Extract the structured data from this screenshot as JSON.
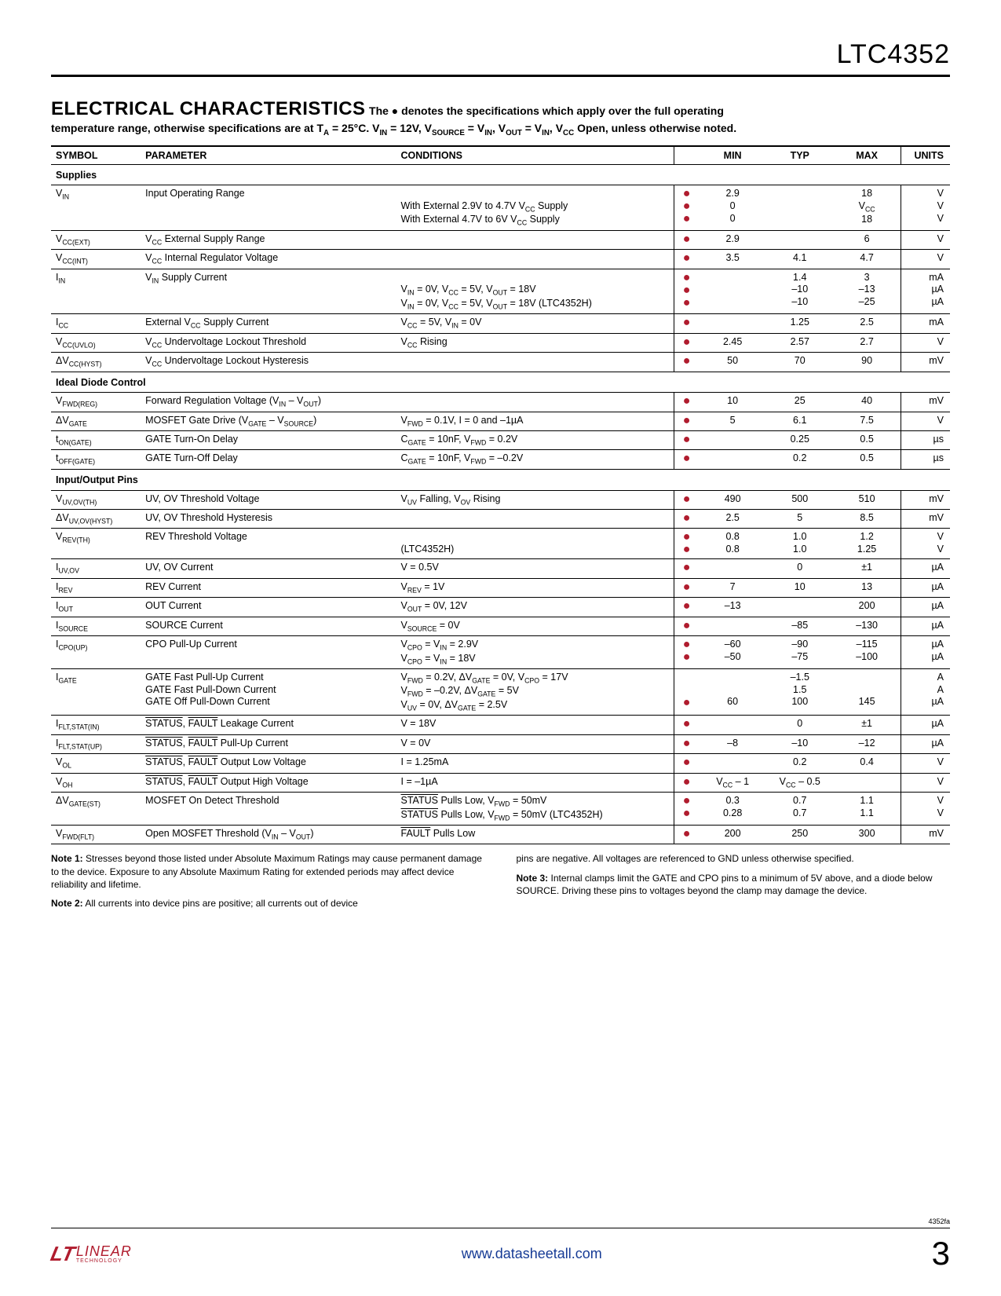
{
  "part_number": "LTC4352",
  "section_title": "ELECTRICAL CHARACTERISTICS",
  "header_text_1": "  The ● denotes the specifications which apply over the full operating",
  "header_text_2": "temperature range, otherwise specifications are at TA = 25°C. VIN = 12V, VSOURCE = VIN, VOUT = VIN, VCC Open, unless otherwise noted.",
  "columns": {
    "symbol": "SYMBOL",
    "parameter": "PARAMETER",
    "conditions": "CONDITIONS",
    "min": "MIN",
    "typ": "TYP",
    "max": "MAX",
    "units": "UNITS"
  },
  "groups": [
    {
      "name": "Supplies",
      "rows": [
        {
          "sym": "V<sub>IN</sub>",
          "param": "Input Operating Range",
          "cond": [
            "",
            "With External 2.9V to 4.7V V<sub>CC</sub> Supply",
            "With External 4.7V to 6V V<sub>CC</sub> Supply"
          ],
          "dot": [
            "●",
            "●",
            "●"
          ],
          "min": [
            "2.9",
            "0",
            "0"
          ],
          "typ": [
            "",
            "",
            ""
          ],
          "max": [
            "18",
            "V<sub>CC</sub>",
            "18"
          ],
          "unit": [
            "V",
            "V",
            "V"
          ]
        },
        {
          "sym": "V<sub>CC(EXT)</sub>",
          "param": "V<sub>CC</sub> External Supply Range",
          "cond": [
            ""
          ],
          "dot": [
            "●"
          ],
          "min": [
            "2.9"
          ],
          "typ": [
            ""
          ],
          "max": [
            "6"
          ],
          "unit": [
            "V"
          ]
        },
        {
          "sym": "V<sub>CC(INT)</sub>",
          "param": "V<sub>CC</sub> Internal Regulator Voltage",
          "cond": [
            ""
          ],
          "dot": [
            "●"
          ],
          "min": [
            "3.5"
          ],
          "typ": [
            "4.1"
          ],
          "max": [
            "4.7"
          ],
          "unit": [
            "V"
          ]
        },
        {
          "sym": "I<sub>IN</sub>",
          "param": "V<sub>IN</sub> Supply Current",
          "cond": [
            "",
            "V<sub>IN</sub> = 0V, V<sub>CC</sub> = 5V, V<sub>OUT</sub> = 18V",
            "V<sub>IN</sub> = 0V, V<sub>CC</sub> = 5V, V<sub>OUT</sub> = 18V (LTC4352H)"
          ],
          "dot": [
            "●",
            "●",
            "●"
          ],
          "min": [
            "",
            "",
            ""
          ],
          "typ": [
            "1.4",
            "–10",
            "–10"
          ],
          "max": [
            "3",
            "–13",
            "–25"
          ],
          "unit": [
            "mA",
            "µA",
            "µA"
          ]
        },
        {
          "sym": "I<sub>CC</sub>",
          "param": "External V<sub>CC</sub> Supply Current",
          "cond": [
            "V<sub>CC</sub> = 5V, V<sub>IN</sub> = 0V"
          ],
          "dot": [
            "●"
          ],
          "min": [
            ""
          ],
          "typ": [
            "1.25"
          ],
          "max": [
            "2.5"
          ],
          "unit": [
            "mA"
          ]
        },
        {
          "sym": "V<sub>CC(UVLO)</sub>",
          "param": "V<sub>CC</sub> Undervoltage Lockout Threshold",
          "cond": [
            "V<sub>CC</sub> Rising"
          ],
          "dot": [
            "●"
          ],
          "min": [
            "2.45"
          ],
          "typ": [
            "2.57"
          ],
          "max": [
            "2.7"
          ],
          "unit": [
            "V"
          ]
        },
        {
          "sym": "ΔV<sub>CC(HYST)</sub>",
          "param": "V<sub>CC</sub> Undervoltage Lockout Hysteresis",
          "cond": [
            ""
          ],
          "dot": [
            "●"
          ],
          "min": [
            "50"
          ],
          "typ": [
            "70"
          ],
          "max": [
            "90"
          ],
          "unit": [
            "mV"
          ]
        }
      ]
    },
    {
      "name": "Ideal Diode Control",
      "rows": [
        {
          "sym": "V<sub>FWD(REG)</sub>",
          "param": "Forward Regulation Voltage (V<sub>IN</sub> – V<sub>OUT</sub>)",
          "cond": [
            ""
          ],
          "dot": [
            "●"
          ],
          "min": [
            "10"
          ],
          "typ": [
            "25"
          ],
          "max": [
            "40"
          ],
          "unit": [
            "mV"
          ]
        },
        {
          "sym": "ΔV<sub>GATE</sub>",
          "param": "MOSFET Gate Drive (V<sub>GATE</sub> – V<sub>SOURCE</sub>)",
          "cond": [
            "V<sub>FWD</sub> = 0.1V, I = 0 and –1µA"
          ],
          "dot": [
            "●"
          ],
          "min": [
            "5"
          ],
          "typ": [
            "6.1"
          ],
          "max": [
            "7.5"
          ],
          "unit": [
            "V"
          ]
        },
        {
          "sym": "t<sub>ON(GATE)</sub>",
          "param": "GATE Turn-On Delay",
          "cond": [
            "C<sub>GATE</sub> = 10nF, V<sub>FWD</sub> = 0.2V"
          ],
          "dot": [
            "●"
          ],
          "min": [
            ""
          ],
          "typ": [
            "0.25"
          ],
          "max": [
            "0.5"
          ],
          "unit": [
            "µs"
          ]
        },
        {
          "sym": "t<sub>OFF(GATE)</sub>",
          "param": "GATE Turn-Off Delay",
          "cond": [
            "C<sub>GATE</sub> = 10nF, V<sub>FWD</sub> = –0.2V"
          ],
          "dot": [
            "●"
          ],
          "min": [
            ""
          ],
          "typ": [
            "0.2"
          ],
          "max": [
            "0.5"
          ],
          "unit": [
            "µs"
          ]
        }
      ]
    },
    {
      "name": "Input/Output Pins",
      "rows": [
        {
          "sym": "V<sub>UV,OV(TH)</sub>",
          "param": "UV, OV Threshold Voltage",
          "cond": [
            "V<sub>UV</sub> Falling, V<sub>OV</sub> Rising"
          ],
          "dot": [
            "●"
          ],
          "min": [
            "490"
          ],
          "typ": [
            "500"
          ],
          "max": [
            "510"
          ],
          "unit": [
            "mV"
          ]
        },
        {
          "sym": "ΔV<sub>UV,OV(HYST)</sub>",
          "param": "UV, OV Threshold Hysteresis",
          "cond": [
            ""
          ],
          "dot": [
            "●"
          ],
          "min": [
            "2.5"
          ],
          "typ": [
            "5"
          ],
          "max": [
            "8.5"
          ],
          "unit": [
            "mV"
          ]
        },
        {
          "sym": "V<sub>REV(TH)</sub>",
          "param": "REV Threshold Voltage",
          "cond": [
            "",
            "(LTC4352H)"
          ],
          "dot": [
            "●",
            "●"
          ],
          "min": [
            "0.8",
            "0.8"
          ],
          "typ": [
            "1.0",
            "1.0"
          ],
          "max": [
            "1.2",
            "1.25"
          ],
          "unit": [
            "V",
            "V"
          ]
        },
        {
          "sym": "I<sub>UV,OV</sub>",
          "param": "UV, OV Current",
          "cond": [
            "V = 0.5V"
          ],
          "dot": [
            "●"
          ],
          "min": [
            ""
          ],
          "typ": [
            "0"
          ],
          "max": [
            "±1"
          ],
          "unit": [
            "µA"
          ]
        },
        {
          "sym": "I<sub>REV</sub>",
          "param": "REV Current",
          "cond": [
            "V<sub>REV</sub> = 1V"
          ],
          "dot": [
            "●"
          ],
          "min": [
            "7"
          ],
          "typ": [
            "10"
          ],
          "max": [
            "13"
          ],
          "unit": [
            "µA"
          ]
        },
        {
          "sym": "I<sub>OUT</sub>",
          "param": "OUT Current",
          "cond": [
            "V<sub>OUT</sub> = 0V, 12V"
          ],
          "dot": [
            "●"
          ],
          "min": [
            "–13"
          ],
          "typ": [
            ""
          ],
          "max": [
            "200"
          ],
          "unit": [
            "µA"
          ]
        },
        {
          "sym": "I<sub>SOURCE</sub>",
          "param": "SOURCE Current",
          "cond": [
            "V<sub>SOURCE</sub> = 0V"
          ],
          "dot": [
            "●"
          ],
          "min": [
            ""
          ],
          "typ": [
            "–85"
          ],
          "max": [
            "–130"
          ],
          "unit": [
            "µA"
          ]
        },
        {
          "sym": "I<sub>CPO(UP)</sub>",
          "param": "CPO Pull-Up Current",
          "cond": [
            "V<sub>CPO</sub> = V<sub>IN</sub> = 2.9V",
            "V<sub>CPO</sub> = V<sub>IN</sub> = 18V"
          ],
          "dot": [
            "●",
            "●"
          ],
          "min": [
            "–60",
            "–50"
          ],
          "typ": [
            "–90",
            "–75"
          ],
          "max": [
            "–115",
            "–100"
          ],
          "unit": [
            "µA",
            "µA"
          ]
        },
        {
          "sym": "I<sub>GATE</sub>",
          "param": "GATE Fast Pull-Up Current<br>GATE Fast Pull-Down Current<br>GATE Off Pull-Down Current",
          "cond": [
            "V<sub>FWD</sub> = 0.2V, ΔV<sub>GATE</sub> = 0V, V<sub>CPO</sub> = 17V",
            "V<sub>FWD</sub> = –0.2V, ΔV<sub>GATE</sub> = 5V",
            "V<sub>UV</sub> = 0V, ΔV<sub>GATE</sub> = 2.5V"
          ],
          "dot": [
            "",
            "",
            "●"
          ],
          "min": [
            "",
            "",
            "60"
          ],
          "typ": [
            "–1.5",
            "1.5",
            "100"
          ],
          "max": [
            "",
            "",
            "145"
          ],
          "unit": [
            "A",
            "A",
            "µA"
          ]
        },
        {
          "sym": "I<sub>FLT,STAT(IN)</sub>",
          "param": "<span class='overline'>STATUS</span>, <span class='overline'>FAULT</span> Leakage Current",
          "cond": [
            "V = 18V"
          ],
          "dot": [
            "●"
          ],
          "min": [
            ""
          ],
          "typ": [
            "0"
          ],
          "max": [
            "±1"
          ],
          "unit": [
            "µA"
          ]
        },
        {
          "sym": "I<sub>FLT,STAT(UP)</sub>",
          "param": "<span class='overline'>STATUS</span>, <span class='overline'>FAULT</span> Pull-Up Current",
          "cond": [
            "V = 0V"
          ],
          "dot": [
            "●"
          ],
          "min": [
            "–8"
          ],
          "typ": [
            "–10"
          ],
          "max": [
            "–12"
          ],
          "unit": [
            "µA"
          ]
        },
        {
          "sym": "V<sub>OL</sub>",
          "param": "<span class='overline'>STATUS</span>, <span class='overline'>FAULT</span> Output Low Voltage",
          "cond": [
            "I = 1.25mA"
          ],
          "dot": [
            "●"
          ],
          "min": [
            ""
          ],
          "typ": [
            "0.2"
          ],
          "max": [
            "0.4"
          ],
          "unit": [
            "V"
          ]
        },
        {
          "sym": "V<sub>OH</sub>",
          "param": "<span class='overline'>STATUS</span>, <span class='overline'>FAULT</span> Output High Voltage",
          "cond": [
            "I = –1µA"
          ],
          "dot": [
            "●"
          ],
          "min": [
            "V<sub>CC</sub> – 1"
          ],
          "typ": [
            "V<sub>CC</sub> – 0.5"
          ],
          "max": [
            ""
          ],
          "unit": [
            "V"
          ]
        },
        {
          "sym": "ΔV<sub>GATE(ST)</sub>",
          "param": "MOSFET On Detect Threshold",
          "cond": [
            "<span class='overline'>STATUS</span> Pulls Low, V<sub>FWD</sub> = 50mV",
            "<span class='overline'>STATUS</span> Pulls Low, V<sub>FWD</sub> = 50mV (LTC4352H)"
          ],
          "dot": [
            "●",
            "●"
          ],
          "min": [
            "0.3",
            "0.28"
          ],
          "typ": [
            "0.7",
            "0.7"
          ],
          "max": [
            "1.1",
            "1.1"
          ],
          "unit": [
            "V",
            "V"
          ]
        },
        {
          "sym": "V<sub>FWD(FLT)</sub>",
          "param": "Open MOSFET Threshold (V<sub>IN</sub> – V<sub>OUT</sub>)",
          "cond": [
            "<span class='overline'>FAULT</span> Pulls Low"
          ],
          "dot": [
            "●"
          ],
          "min": [
            "200"
          ],
          "typ": [
            "250"
          ],
          "max": [
            "300"
          ],
          "unit": [
            "mV"
          ]
        }
      ]
    }
  ],
  "notes": {
    "left": [
      "<b>Note 1:</b> Stresses beyond those listed under Absolute Maximum Ratings may cause permanent damage to the device. Exposure to any Absolute Maximum Rating for extended periods may affect device reliability and lifetime.",
      "<b>Note 2:</b> All currents into device pins are positive; all currents out of device"
    ],
    "right": [
      "pins are negative. All voltages are referenced to GND unless otherwise specified.",
      "<b>Note 3:</b> Internal clamps limit the GATE and CPO pins to a minimum of 5V above, and a diode below SOURCE. Driving these pins to voltages beyond the clamp may damage the device."
    ]
  },
  "footer": {
    "url": "www.datasheetall.com",
    "page": "3",
    "docid": "4352fa",
    "logo_text": "LINEAR",
    "logo_sub": "TECHNOLOGY"
  }
}
